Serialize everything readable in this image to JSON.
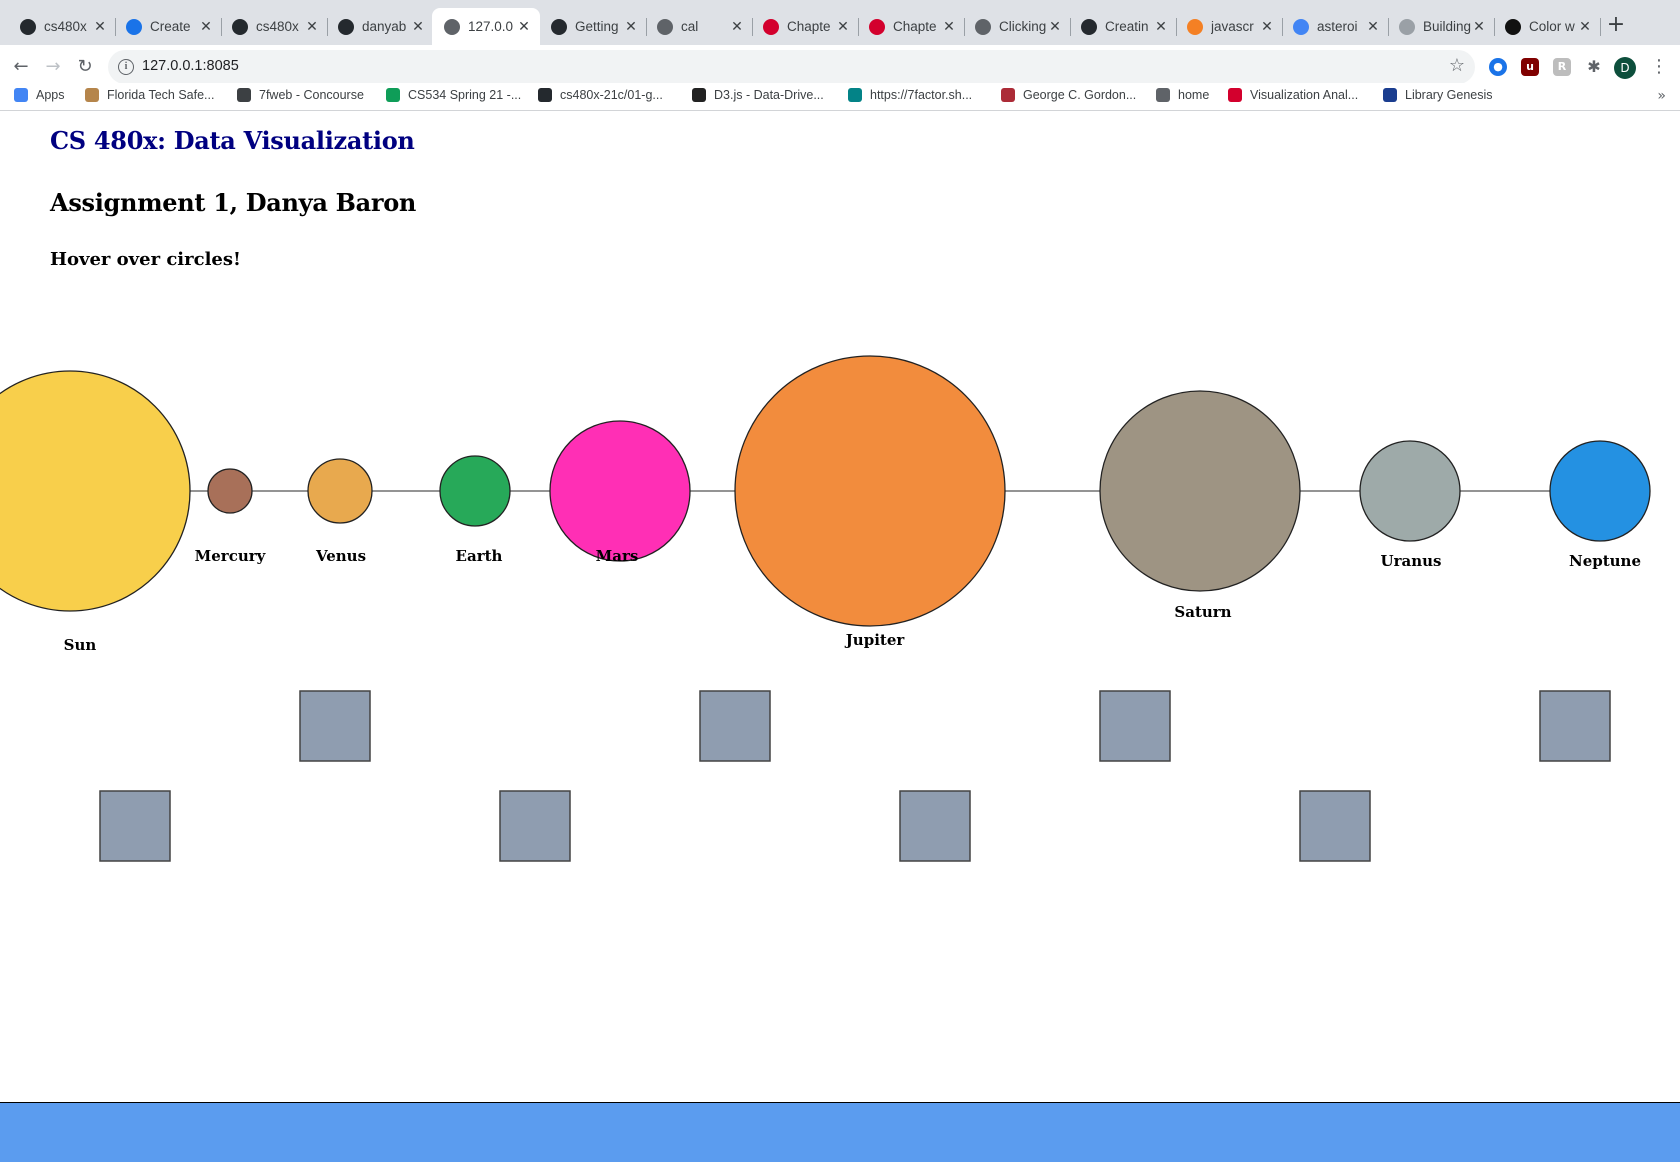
{
  "browser": {
    "tabs": [
      {
        "label": "cs480x",
        "favicon": "github-icon",
        "color": "#24292e"
      },
      {
        "label": "Create",
        "favicon": "typeform-icon",
        "color": "#1a73e8"
      },
      {
        "label": "cs480x",
        "favicon": "github-icon",
        "color": "#24292e"
      },
      {
        "label": "danyab",
        "favicon": "github-icon",
        "color": "#24292e"
      },
      {
        "label": "127.0.0",
        "favicon": "globe-icon",
        "color": "#5f6368",
        "active": true
      },
      {
        "label": "Getting",
        "favicon": "github-icon",
        "color": "#24292e"
      },
      {
        "label": "cal",
        "favicon": "globe-icon",
        "color": "#5f6368"
      },
      {
        "label": "Chapte",
        "favicon": "oreilly-icon",
        "color": "#d3002d"
      },
      {
        "label": "Chapte",
        "favicon": "oreilly-icon",
        "color": "#d3002d"
      },
      {
        "label": "Clicking",
        "favicon": "globe-icon",
        "color": "#5f6368"
      },
      {
        "label": "Creatin",
        "favicon": "github-icon",
        "color": "#24292e"
      },
      {
        "label": "javascr",
        "favicon": "stackoverflow-icon",
        "color": "#f48024"
      },
      {
        "label": "asteroi",
        "favicon": "google-icon",
        "color": "#4285f4"
      },
      {
        "label": "Building",
        "favicon": "observable-icon",
        "color": "#9aa0a6"
      },
      {
        "label": "Color w",
        "favicon": "colorhunt-icon",
        "color": "#111111"
      }
    ],
    "url": "127.0.0.1:8085",
    "profile_initial": "D",
    "bookmarks": [
      {
        "label": "Apps",
        "icon": "apps-grid-icon",
        "color": "#4285f4"
      },
      {
        "label": "Florida Tech Safe...",
        "icon": "florida-tech-icon",
        "color": "#b5854b"
      },
      {
        "label": "7fweb - Concourse",
        "icon": "concourse-icon",
        "color": "#3c4043"
      },
      {
        "label": "CS534 Spring 21 -...",
        "icon": "sheets-icon",
        "color": "#0f9d58"
      },
      {
        "label": "cs480x-21c/01-g...",
        "icon": "github-icon",
        "color": "#24292e"
      },
      {
        "label": "D3.js - Data-Drive...",
        "icon": "d3-icon",
        "color": "#222222"
      },
      {
        "label": "https://7factor.sh...",
        "icon": "sharepoint-icon",
        "color": "#038387"
      },
      {
        "label": "George C. Gordon...",
        "icon": "wpi-icon",
        "color": "#ac2b37"
      },
      {
        "label": "home",
        "icon": "globe-icon",
        "color": "#5f6368"
      },
      {
        "label": "Visualization Anal...",
        "icon": "oreilly-icon",
        "color": "#d3002d"
      },
      {
        "label": "Library Genesis",
        "icon": "library-icon",
        "color": "#1a3d8f"
      }
    ]
  },
  "page": {
    "course_title": "CS 480x: Data Visualization",
    "assignment_title": "Assignment 1, Danya Baron",
    "hint": "Hover over circles!",
    "planets": [
      {
        "name": "Sun",
        "color": "#f8cf4b"
      },
      {
        "name": "Mercury",
        "color": "#a87059"
      },
      {
        "name": "Venus",
        "color": "#e8a94e"
      },
      {
        "name": "Earth",
        "color": "#27a959"
      },
      {
        "name": "Mars",
        "color": "#ff2fb5"
      },
      {
        "name": "Jupiter",
        "color": "#f28c3d"
      },
      {
        "name": "Saturn",
        "color": "#9e9483"
      },
      {
        "name": "Uranus",
        "color": "#9eaaa9"
      },
      {
        "name": "Neptune",
        "color": "#2491e2"
      }
    ],
    "square_color": "#8f9db0",
    "footer_color": "#5b9cef"
  }
}
